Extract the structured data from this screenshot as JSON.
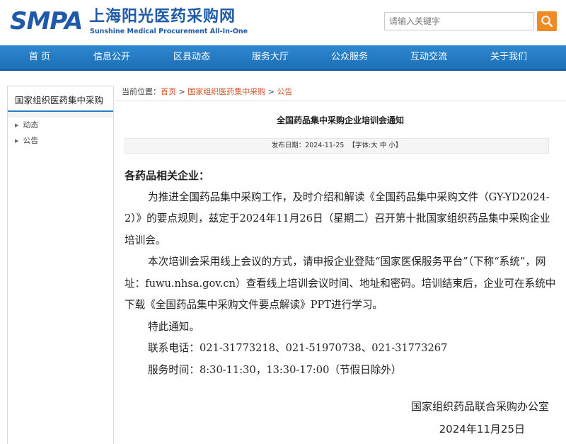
{
  "header": {
    "logo_mark": "SMPA",
    "logo_cn": "上海阳光医药采购网",
    "logo_en": "Sunshine Medical Procurement All-In-One",
    "search_placeholder": "请输入关键字"
  },
  "nav": [
    "首 页",
    "信息公开",
    "区县动态",
    "服务大厅",
    "公众服务",
    "互动交流",
    "关于我们"
  ],
  "sidebar": {
    "title": "国家组织医药集中采购",
    "items": [
      "动态",
      "公告"
    ]
  },
  "breadcrumb": {
    "prefix": "当前位置：",
    "home": "首页",
    "sep1": " > ",
    "section": "国家组织医药集中采购",
    "sep2": " > ",
    "current": "公告"
  },
  "article": {
    "title": "全国药品集中采购企业培训会通知",
    "meta_prefix": "发布日期：2024-11-25",
    "font_label": "【字体:",
    "font_large": "大",
    "font_medium": "中",
    "font_small": "小",
    "font_end": "】",
    "salutation": "各药品相关企业：",
    "para1": "为推进全国药品集中采购工作，及时介绍和解读《全国药品集中采购文件（GY-YD2024-2）》的要点规则，兹定于2024年11月26日（星期二）召开第十批国家组织药品集中采购企业培训会。",
    "para2": "本次培训会采用线上会议的方式，请申报企业登陆“国家医保服务平台”（下称“系统”，网址：fuwu.nhsa.gov.cn）查看线上培训会议时间、地址和密码。培训结束后，企业可在系统中下载《全国药品集中采购文件要点解读》PPT进行学习。",
    "para3": "特此通知。",
    "contact": "联系电话：021-31773218、021-51970738、021-31773267",
    "hours": "服务时间：8:30-11:30，13:30-17:00（节假日除外）",
    "signer": "国家组织药品联合采购办公室",
    "date": "2024年11月25日"
  },
  "colors": {
    "brand_blue": "#1e5aa8",
    "nav_blue": "#2478c0",
    "link_orange": "#d4532b",
    "search_orange": "#f08a24"
  }
}
